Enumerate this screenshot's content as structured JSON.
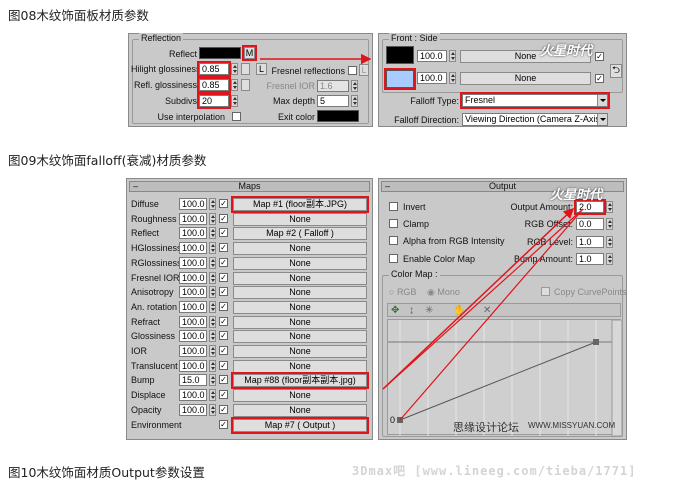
{
  "captions": {
    "fig08": "图08木纹饰面板材质参数",
    "fig09": "图09木纹饰面falloff(衰减)材质参数",
    "fig10": "图10木纹饰面材质Output参数设置"
  },
  "reflection": {
    "title": "Reflection",
    "reflect_label": "Reflect",
    "m_label": "M",
    "hilight_label": "Hilight glossiness",
    "hilight_value": "0.85",
    "l_label": "L",
    "refl_gloss_label": "Refl. glossiness",
    "refl_gloss_value": "0.85",
    "subdivs_label": "Subdivs",
    "subdivs_value": "20",
    "use_interp_label": "Use interpolation",
    "fresnel_refl_label": "Fresnel reflections",
    "fresnel_ior_label": "Fresnel IOR",
    "fresnel_ior_value": "1.6",
    "max_depth_label": "Max depth",
    "max_depth_value": "5",
    "exit_color_label": "Exit color"
  },
  "front_side": {
    "title": "Front : Side",
    "value1": "100.0",
    "map1": "None",
    "value2": "100.0",
    "map2": "None",
    "falloff_type_label": "Falloff Type:",
    "falloff_type_value": "Fresnel",
    "falloff_dir_label": "Falloff Direction:",
    "falloff_dir_value": "Viewing Direction (Camera Z-Axis)"
  },
  "maps": {
    "title": "Maps",
    "rows": [
      {
        "name": "Diffuse",
        "value": "100.0",
        "checked": true,
        "map": "Map #1 (floor副本.JPG)",
        "highlight": true
      },
      {
        "name": "Roughness",
        "value": "100.0",
        "checked": true,
        "map": "None",
        "highlight": false
      },
      {
        "name": "Reflect",
        "value": "100.0",
        "checked": true,
        "map": "Map #2 ( Falloff )",
        "highlight": false
      },
      {
        "name": "HGlossiness",
        "value": "100.0",
        "checked": true,
        "map": "None",
        "highlight": false
      },
      {
        "name": "RGlossiness",
        "value": "100.0",
        "checked": true,
        "map": "None",
        "highlight": false
      },
      {
        "name": "Fresnel IOR",
        "value": "100.0",
        "checked": true,
        "map": "None",
        "highlight": false
      },
      {
        "name": "Anisotropy",
        "value": "100.0",
        "checked": true,
        "map": "None",
        "highlight": false
      },
      {
        "name": "An. rotation",
        "value": "100.0",
        "checked": true,
        "map": "None",
        "highlight": false
      },
      {
        "name": "Refract",
        "value": "100.0",
        "checked": true,
        "map": "None",
        "highlight": false
      },
      {
        "name": "Glossiness",
        "value": "100.0",
        "checked": true,
        "map": "None",
        "highlight": false
      },
      {
        "name": "IOR",
        "value": "100.0",
        "checked": true,
        "map": "None",
        "highlight": false
      },
      {
        "name": "Translucent",
        "value": "100.0",
        "checked": true,
        "map": "None",
        "highlight": false
      },
      {
        "name": "Bump",
        "value": "15.0",
        "checked": true,
        "map": "Map #88 (floor副本副本.jpg)",
        "highlight": true
      },
      {
        "name": "Displace",
        "value": "100.0",
        "checked": true,
        "map": "None",
        "highlight": false
      },
      {
        "name": "Opacity",
        "value": "100.0",
        "checked": true,
        "map": "None",
        "highlight": false
      },
      {
        "name": "Environment",
        "value": "",
        "checked": true,
        "map": "Map #7 ( Output )",
        "highlight": true
      }
    ]
  },
  "output": {
    "title": "Output",
    "invert_label": "Invert",
    "output_amount_label": "Output Amount:",
    "output_amount_value": "2.0",
    "clamp_label": "Clamp",
    "rgb_offset_label": "RGB Offset:",
    "rgb_offset_value": "0.0",
    "alpha_label": "Alpha from RGB Intensity",
    "rgb_level_label": "RGB Level:",
    "rgb_level_value": "1.0",
    "enable_color_map_label": "Enable Color Map",
    "bump_amount_label": "Bump Amount:",
    "bump_amount_value": "1.0",
    "color_map_title": "Color Map :",
    "rgb_label": "RGB",
    "mono_label": "Mono",
    "copy_curve_label": "Copy CurvePoints",
    "curve_y0": "0"
  },
  "watermarks": {
    "logo1": "火星时代",
    "logo2": "火星时代",
    "forum": "思缘设计论坛",
    "forum_url": "WWW.MISSYUAN.COM",
    "bottom": "3Dmax吧 [www.lineeg.com/tieba/1771]"
  },
  "colors": {
    "panel_bg": "#c9c9c9",
    "highlight": "#e0141b",
    "swatch_black": "#000000",
    "swatch_blue": "#a8ccff"
  }
}
